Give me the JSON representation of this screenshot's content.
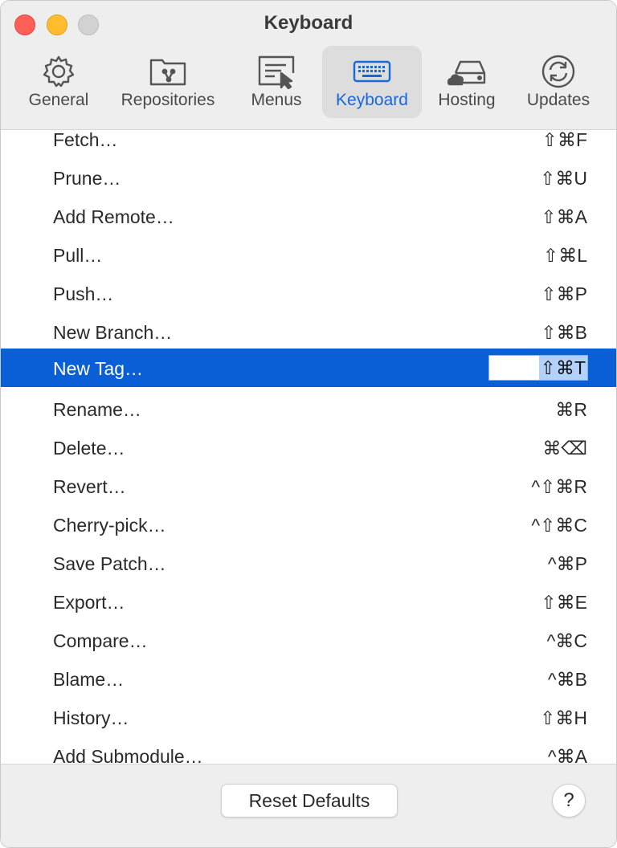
{
  "window": {
    "title": "Keyboard"
  },
  "toolbar": {
    "tabs": [
      {
        "label": "General",
        "icon": "gear-icon",
        "active": false
      },
      {
        "label": "Repositories",
        "icon": "repository-folder-icon",
        "active": false
      },
      {
        "label": "Menus",
        "icon": "menu-cursor-icon",
        "active": false
      },
      {
        "label": "Keyboard",
        "icon": "keyboard-icon",
        "active": true
      },
      {
        "label": "Hosting",
        "icon": "cloud-drive-icon",
        "active": false
      },
      {
        "label": "Updates",
        "icon": "refresh-icon",
        "active": false
      }
    ]
  },
  "shortcuts": [
    {
      "command": "Fetch…",
      "shortcut": "⇧⌘F"
    },
    {
      "command": "Prune…",
      "shortcut": "⇧⌘U"
    },
    {
      "command": "Add Remote…",
      "shortcut": "⇧⌘A"
    },
    {
      "command": "Pull…",
      "shortcut": "⇧⌘L"
    },
    {
      "command": "Push…",
      "shortcut": "⇧⌘P"
    },
    {
      "command": "New Branch…",
      "shortcut": "⇧⌘B"
    },
    {
      "command": "New Tag…",
      "shortcut": "⇧⌘T",
      "selected": true
    },
    {
      "command": "Rename…",
      "shortcut": "⌘R"
    },
    {
      "command": "Delete…",
      "shortcut": "⌘⌫"
    },
    {
      "command": "Revert…",
      "shortcut": "^⇧⌘R"
    },
    {
      "command": "Cherry-pick…",
      "shortcut": "^⇧⌘C"
    },
    {
      "command": "Save Patch…",
      "shortcut": "^⌘P"
    },
    {
      "command": "Export…",
      "shortcut": "⇧⌘E"
    },
    {
      "command": "Compare…",
      "shortcut": "^⌘C"
    },
    {
      "command": "Blame…",
      "shortcut": "^⌘B"
    },
    {
      "command": "History…",
      "shortcut": "⇧⌘H"
    },
    {
      "command": "Add Submodule…",
      "shortcut": "^⌘A"
    }
  ],
  "footer": {
    "reset_label": "Reset Defaults",
    "help_label": "?"
  },
  "colors": {
    "accent": "#0a5fd6",
    "selection_highlight": "#b2d2fb",
    "active_tab_text": "#1668dc"
  }
}
